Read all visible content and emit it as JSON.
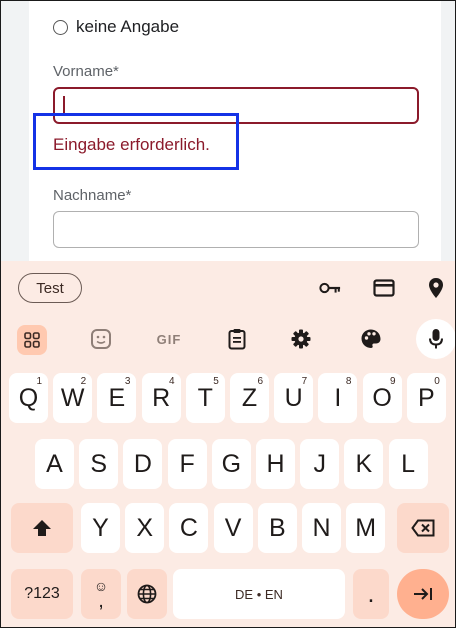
{
  "form": {
    "radio_label": "keine Angabe",
    "first_name_label": "Vorname*",
    "error_message": "Eingabe erforderlich.",
    "last_name_label": "Nachname*"
  },
  "keyboard": {
    "suggestion_chip": "Test",
    "suggestion_icons": [
      "key-icon",
      "card-icon",
      "location-pin-icon"
    ],
    "toolbar": {
      "gif_label": "GIF"
    },
    "row1": [
      {
        "k": "Q",
        "h": "1"
      },
      {
        "k": "W",
        "h": "2"
      },
      {
        "k": "E",
        "h": "3"
      },
      {
        "k": "R",
        "h": "4"
      },
      {
        "k": "T",
        "h": "5"
      },
      {
        "k": "Z",
        "h": "6"
      },
      {
        "k": "U",
        "h": "7"
      },
      {
        "k": "I",
        "h": "8"
      },
      {
        "k": "O",
        "h": "9"
      },
      {
        "k": "P",
        "h": "0"
      }
    ],
    "row2": [
      "A",
      "S",
      "D",
      "F",
      "G",
      "H",
      "J",
      "K",
      "L"
    ],
    "row3": [
      "Y",
      "X",
      "C",
      "V",
      "B",
      "N",
      "M"
    ],
    "sym_key": "?123",
    "emoji_comma": ",",
    "space_label": "DE • EN",
    "period_key": "."
  }
}
